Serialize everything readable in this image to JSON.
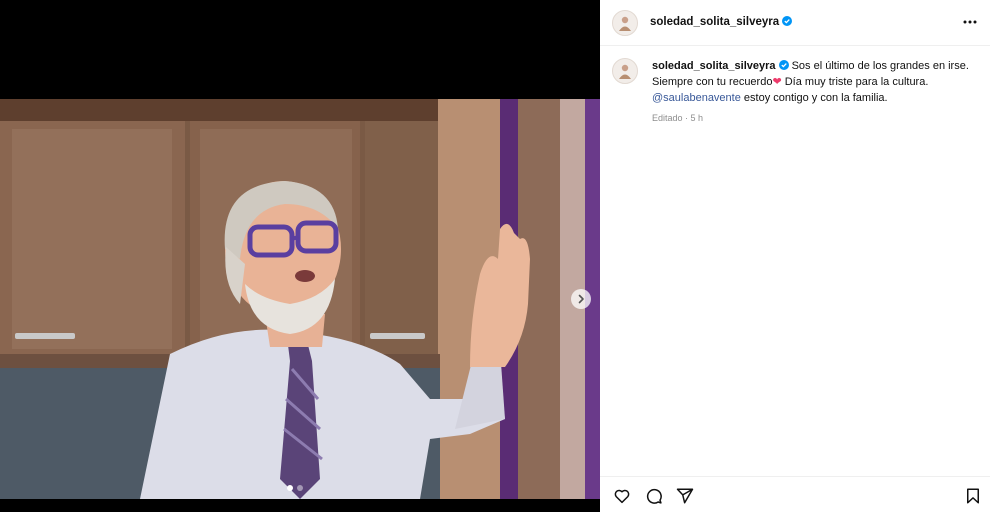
{
  "post": {
    "username": "soledad_solita_silveyra",
    "verified_icon": "verified-badge-icon",
    "caption": {
      "line1": "Sos el último de los grandes en irse.",
      "line2a": "Siempre con tu recuerdo",
      "heart": "❤",
      "line2b": " Día muy triste para la cultura.",
      "mention": "@saulabenavente",
      "line3": " estoy contigo y con la familia."
    },
    "meta": "Editado · 5 h"
  },
  "media": {
    "carousel_total": 2,
    "carousel_active": 1
  },
  "icons": {
    "more": "more-options-icon",
    "like": "heart-icon",
    "comment": "comment-icon",
    "share": "share-icon",
    "save": "bookmark-icon",
    "next": "chevron-right-icon"
  },
  "colors": {
    "mention": "#385898",
    "verified": "#0095f6",
    "heart": "#ed3b6b"
  }
}
